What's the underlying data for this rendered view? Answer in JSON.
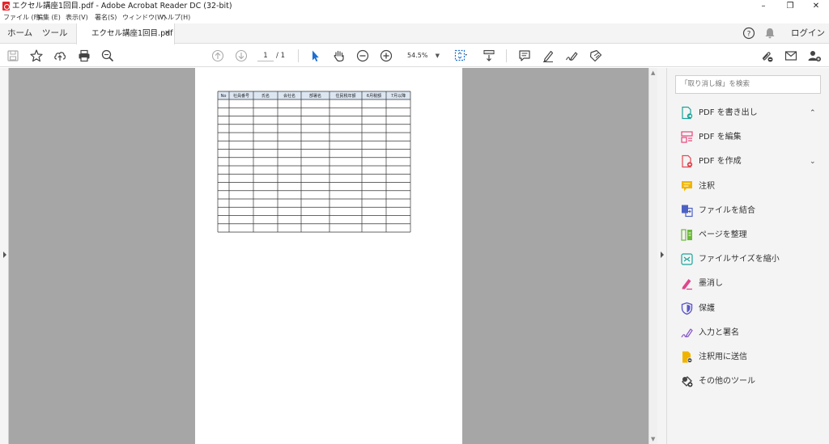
{
  "window": {
    "title": "エクセル講座1回目.pdf - Adobe Acrobat Reader DC (32-bit)",
    "min_glyph": "–",
    "max_glyph": "❐",
    "close_glyph": "✕"
  },
  "menu": [
    "ファイル (F)",
    "編集 (E)",
    "表示(V)",
    "署名(S)",
    "ウィンドウ(W)",
    "ヘルプ(H)"
  ],
  "tabs": {
    "home": "ホーム",
    "tools": "ツール",
    "document": "エクセル講座1回目.pdf",
    "close": "×",
    "signin": "ログイン"
  },
  "toolbar": {
    "page_current": "1",
    "page_total": "/ 1",
    "zoom": "54.5%",
    "zoom_caret": "▼"
  },
  "table": {
    "headers": [
      "No",
      "社員番号",
      "氏名",
      "会社名",
      "部署名",
      "住民税年額",
      "6月税額",
      "7月以降"
    ],
    "row_count": 16
  },
  "panel": {
    "search_placeholder": "「取り消し線」を検索",
    "tools": [
      {
        "label": "PDF を書き出し",
        "icon": "export-pdf-icon",
        "color": "#1aa39b",
        "chevron": "⌃"
      },
      {
        "label": "PDF を編集",
        "icon": "edit-pdf-icon",
        "color": "#e8447d",
        "chevron": ""
      },
      {
        "label": "PDF を作成",
        "icon": "create-pdf-icon",
        "color": "#e34850",
        "chevron": "⌄"
      },
      {
        "label": "注釈",
        "icon": "comment-icon",
        "color": "#f0b400",
        "chevron": ""
      },
      {
        "label": "ファイルを結合",
        "icon": "combine-files-icon",
        "color": "#4b62c4",
        "chevron": ""
      },
      {
        "label": "ページを整理",
        "icon": "organize-pages-icon",
        "color": "#6cb93a",
        "chevron": ""
      },
      {
        "label": "ファイルサイズを縮小",
        "icon": "compress-icon",
        "color": "#1aa39b",
        "chevron": ""
      },
      {
        "label": "墨消し",
        "icon": "redact-icon",
        "color": "#e0458c",
        "chevron": ""
      },
      {
        "label": "保護",
        "icon": "protect-icon",
        "color": "#5b57c8",
        "chevron": ""
      },
      {
        "label": "入力と署名",
        "icon": "fill-sign-icon",
        "color": "#8b5cc9",
        "chevron": ""
      },
      {
        "label": "注釈用に送信",
        "icon": "send-for-comments-icon",
        "color": "#f0b400",
        "chevron": ""
      },
      {
        "label": "その他のツール",
        "icon": "more-tools-icon",
        "color": "#444444",
        "chevron": ""
      }
    ]
  }
}
